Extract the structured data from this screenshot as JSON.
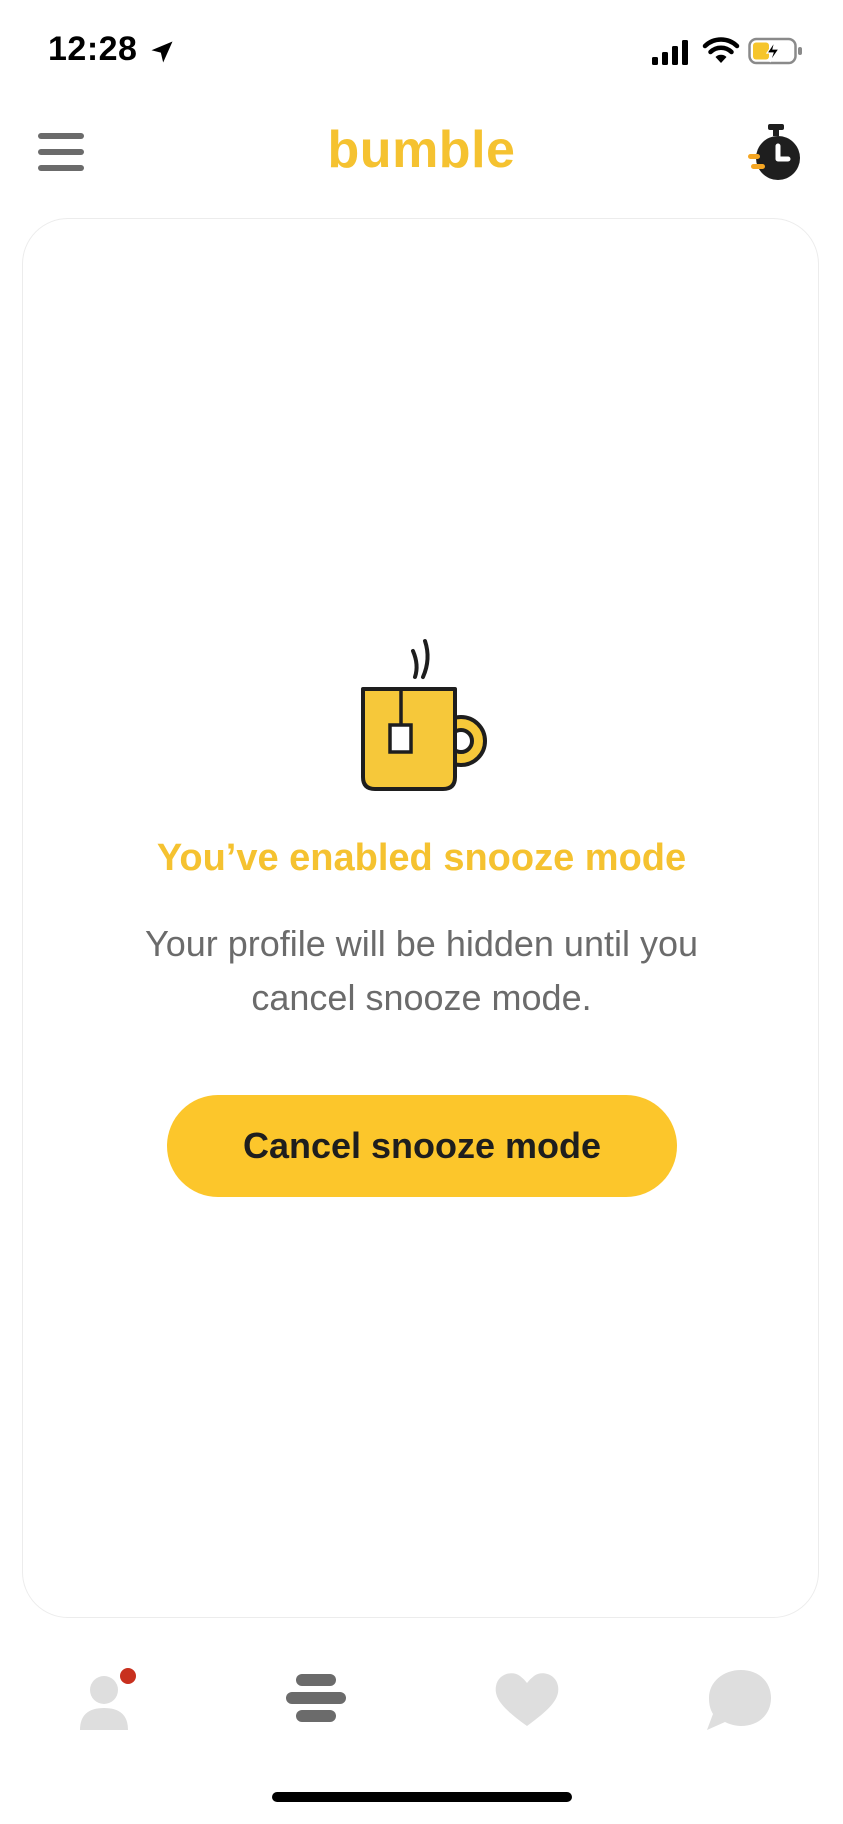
{
  "status_bar": {
    "time": "12:28",
    "icons": [
      "location-arrow-icon",
      "cellular-signal-icon",
      "wifi-icon",
      "battery-charging-icon"
    ]
  },
  "header": {
    "logo_text": "bumble",
    "left_icon": "menu-icon",
    "right_icon": "snooze-stopwatch-icon"
  },
  "snooze": {
    "illustration": "tea-mug-icon",
    "title": "You’ve enabled snooze mode",
    "message": "Your profile will be hidden until you cancel snooze mode.",
    "cancel_button_label": "Cancel snooze mode"
  },
  "bottom_nav": {
    "items": [
      {
        "icon": "profile-icon",
        "has_notification_dot": true
      },
      {
        "icon": "discover-icon",
        "active": true
      },
      {
        "icon": "heart-icon"
      },
      {
        "icon": "chat-bubble-icon"
      }
    ]
  },
  "colors": {
    "brand_yellow": "#f5c230",
    "button_yellow": "#fcc62b",
    "notification_red": "#c8301e",
    "nav_active": "#6b6b6b",
    "nav_inactive": "#dedede"
  }
}
